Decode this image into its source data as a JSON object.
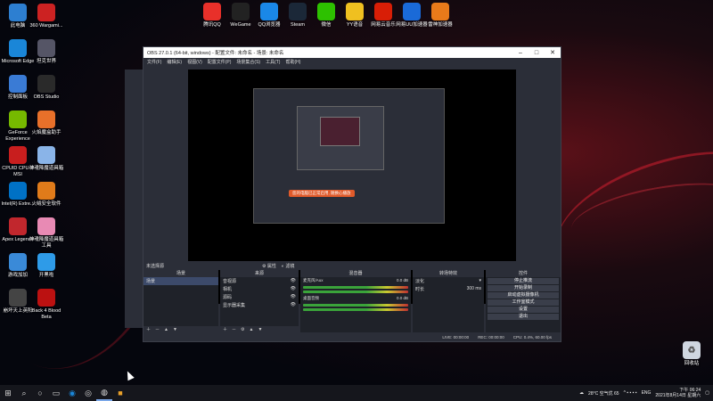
{
  "desktop": {
    "left_icons": [
      {
        "label": "此电脑",
        "icon": "computer-icon",
        "color": "#2d7fd1"
      },
      {
        "label": "360 Wargami...",
        "icon": "360-icon",
        "color": "#cc2222"
      },
      {
        "label": "Microsoft Edge",
        "icon": "edge-icon",
        "color": "#1a86d8"
      },
      {
        "label": "坦克世界",
        "icon": "wot-icon",
        "color": "#555566"
      },
      {
        "label": "控制面板",
        "icon": "control-panel-icon",
        "color": "#3a7bd5"
      },
      {
        "label": "OBS Studio",
        "icon": "obs-icon",
        "color": "#2a2a2a"
      },
      {
        "label": "GeForce Experience",
        "icon": "geforce-icon",
        "color": "#76b900"
      },
      {
        "label": "火焰魔盒助手",
        "icon": "fire-icon",
        "color": "#e8702a"
      },
      {
        "label": "CPUID CPU-Z MSI",
        "icon": "cpuz-icon",
        "color": "#c81e1e"
      },
      {
        "label": "神魂降魔道具箱",
        "icon": "anime-icon",
        "color": "#8ab4e8"
      },
      {
        "label": "Intel(R) Extre...",
        "icon": "intel-icon",
        "color": "#0071c5"
      },
      {
        "label": "火绒安全软件",
        "icon": "shield-icon",
        "color": "#e07b1a"
      },
      {
        "label": "Apex Legends",
        "icon": "apex-icon",
        "color": "#c1272d"
      },
      {
        "label": "神魂降魔道具箱工具",
        "icon": "anime2-icon",
        "color": "#e88ab4"
      },
      {
        "label": "游戏加加",
        "icon": "game-plus-icon",
        "color": "#3a8ad8"
      },
      {
        "label": "开黑啦",
        "icon": "chat-icon",
        "color": "#2e9be8"
      },
      {
        "label": "崩坏天上英阳",
        "icon": "game-icon",
        "color": "#444"
      },
      {
        "label": "Back 4 Blood Beta",
        "icon": "b4b-icon",
        "color": "#b11"
      }
    ],
    "top_icons": [
      {
        "label": "腾讯QQ",
        "icon": "qq-icon",
        "color": "#e8302a"
      },
      {
        "label": "WeGame",
        "icon": "wegame-icon",
        "color": "#222"
      },
      {
        "label": "QQ浏览器",
        "icon": "qq-browser-icon",
        "color": "#1a88e8"
      },
      {
        "label": "Steam",
        "icon": "steam-icon",
        "color": "#1b2838"
      },
      {
        "label": "微信",
        "icon": "wechat-icon",
        "color": "#2dc100"
      },
      {
        "label": "YY语音",
        "icon": "yy-icon",
        "color": "#f0c020"
      },
      {
        "label": "网易云音乐",
        "icon": "netease-music-icon",
        "color": "#d81e06"
      },
      {
        "label": "网易UU加速器",
        "icon": "uu-icon",
        "color": "#1a6ad8"
      },
      {
        "label": "雷神加速器",
        "icon": "leishen-icon",
        "color": "#e87a1a"
      }
    ],
    "recycle_bin": {
      "label": "回收站",
      "icon": "recycle-bin-icon"
    }
  },
  "obs": {
    "title": "OBS 27.0.1 (64-bit, windows) - 配置文件: 未命名 - 场景: 未命名",
    "menu": [
      "文件(F)",
      "编辑(E)",
      "视图(V)",
      "配置文件(P)",
      "场景集合(S)",
      "工具(T)",
      "帮助(H)"
    ],
    "toast": "您的电脑已正常启用, 随换心播放",
    "scene_bar": {
      "left": "未选择源",
      "props": "属性",
      "filters": "滤镜"
    },
    "docks": {
      "scenes": {
        "title": "场景",
        "items": [
          "场景"
        ]
      },
      "sources": {
        "title": "来源",
        "items": [
          "音视源",
          "相机",
          "源码",
          "显示器采集"
        ]
      },
      "mixer": {
        "title": "混音器",
        "rows": [
          {
            "name": "麦克风/Aux",
            "db": "0.0 dB"
          },
          {
            "name": "桌面音频",
            "db": "0.0 dB"
          }
        ]
      },
      "transitions": {
        "title": "转场特效",
        "type": "淡化",
        "duration_label": "时长",
        "duration": "300 ms"
      },
      "controls": {
        "title": "控件",
        "buttons": [
          "停止推流",
          "开始录制",
          "启动虚拟摄像机",
          "工作室模式",
          "设置",
          "退出"
        ]
      }
    },
    "status": {
      "live": "LIVE: 00:00:00",
      "rec": "REC: 00:00:00",
      "cpu": "CPU: 0.4%, 60.00 fps"
    }
  },
  "taskbar": {
    "weather": "28°C 空气优 65",
    "lang": "ENG",
    "time": "下午 06:24",
    "date": "2021年8月14日 星期六"
  }
}
